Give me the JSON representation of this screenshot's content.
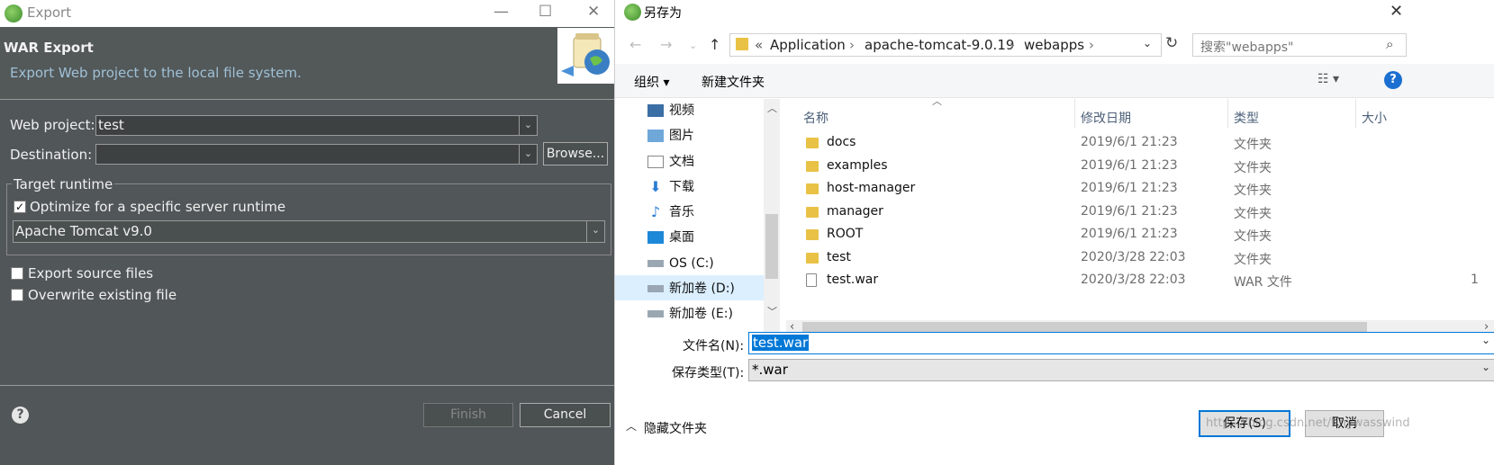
{
  "export_dialog": {
    "window_title": "Export",
    "header_title": "WAR Export",
    "header_subtitle": "Export Web project to the local file system.",
    "web_project_label": "Web project:",
    "web_project_value": "test",
    "destination_label": "Destination:",
    "destination_value": "",
    "browse_label": "Browse...",
    "target_runtime_group": "Target runtime",
    "optimize_label": "Optimize for a specific server runtime",
    "optimize_checked": true,
    "runtime_value": "Apache Tomcat v9.0",
    "export_source_label": "Export source files",
    "export_source_checked": false,
    "overwrite_label": "Overwrite existing file",
    "overwrite_checked": false,
    "finish_label": "Finish",
    "cancel_label": "Cancel"
  },
  "save_dialog": {
    "window_title": "另存为",
    "breadcrumb": [
      "Application",
      "apache-tomcat-9.0.19",
      "webapps"
    ],
    "breadcrumb_overflow": "«",
    "search_placeholder": "搜索\"webapps\"",
    "toolbar": {
      "organize": "组织",
      "new_folder": "新建文件夹"
    },
    "nav_items": [
      {
        "label": "视频",
        "icon": "video-icon"
      },
      {
        "label": "图片",
        "icon": "picture-icon"
      },
      {
        "label": "文档",
        "icon": "document-icon"
      },
      {
        "label": "下载",
        "icon": "download-icon"
      },
      {
        "label": "音乐",
        "icon": "music-icon"
      },
      {
        "label": "桌面",
        "icon": "desktop-icon"
      },
      {
        "label": "OS (C:)",
        "icon": "drive-icon"
      },
      {
        "label": "新加卷 (D:)",
        "icon": "drive-icon",
        "selected": true
      },
      {
        "label": "新加卷 (E:)",
        "icon": "drive-icon"
      }
    ],
    "columns": {
      "name": "名称",
      "date": "修改日期",
      "type": "类型",
      "size": "大小"
    },
    "files": [
      {
        "name": "docs",
        "date": "2019/6/1 21:23",
        "type": "文件夹",
        "size": "",
        "kind": "folder"
      },
      {
        "name": "examples",
        "date": "2019/6/1 21:23",
        "type": "文件夹",
        "size": "",
        "kind": "folder"
      },
      {
        "name": "host-manager",
        "date": "2019/6/1 21:23",
        "type": "文件夹",
        "size": "",
        "kind": "folder"
      },
      {
        "name": "manager",
        "date": "2019/6/1 21:23",
        "type": "文件夹",
        "size": "",
        "kind": "folder"
      },
      {
        "name": "ROOT",
        "date": "2019/6/1 21:23",
        "type": "文件夹",
        "size": "",
        "kind": "folder"
      },
      {
        "name": "test",
        "date": "2020/3/28 22:03",
        "type": "文件夹",
        "size": "",
        "kind": "folder"
      },
      {
        "name": "test.war",
        "date": "2020/3/28 22:03",
        "type": "WAR 文件",
        "size": "1",
        "kind": "file"
      }
    ],
    "filename_label": "文件名(N):",
    "filename_value": "test.war",
    "filetype_label": "保存类型(T):",
    "filetype_value": "*.war",
    "hide_folders_label": "隐藏文件夹",
    "save_label": "保存(S)",
    "cancel_label": "取消",
    "watermark": "https://blog.csdn.net/tinywasswind"
  }
}
